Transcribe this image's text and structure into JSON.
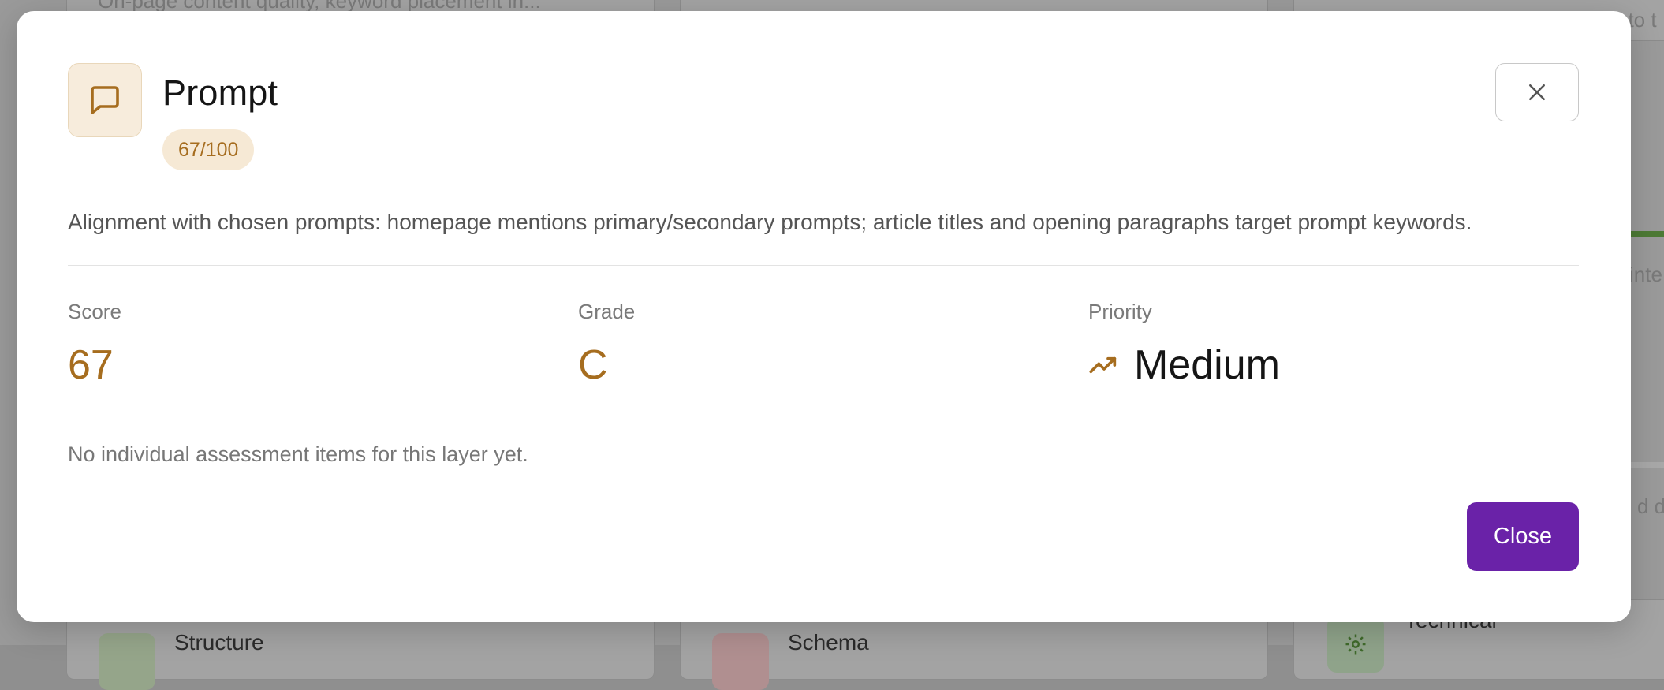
{
  "background": {
    "top_snippets": [
      "On-page content quality, keyword placement in...",
      "",
      "nto t"
    ],
    "right_snippets": [
      "inte",
      "d da"
    ],
    "bottom_cards": [
      {
        "label": "Structure",
        "icon": "structure-icon"
      },
      {
        "label": "Schema",
        "icon": "schema-icon"
      },
      {
        "label": "Technical",
        "icon": "gear-icon"
      }
    ]
  },
  "modal": {
    "icon": "message-square-icon",
    "title": "Prompt",
    "score_badge": "67/100",
    "description": "Alignment with chosen prompts: homepage mentions primary/secondary prompts; article titles and opening paragraphs target prompt keywords.",
    "stats": {
      "score_label": "Score",
      "score_value": "67",
      "grade_label": "Grade",
      "grade_value": "C",
      "priority_label": "Priority",
      "priority_value": "Medium",
      "priority_icon": "trending-up-icon"
    },
    "empty_message": "No individual assessment items for this layer yet.",
    "close_label": "Close",
    "close_icon": "close-icon"
  },
  "colors": {
    "accent": "#a66d1f",
    "badge_bg": "#f6e9d5",
    "primary_button": "#6a22a8",
    "overlay": "#9a9a9a"
  }
}
